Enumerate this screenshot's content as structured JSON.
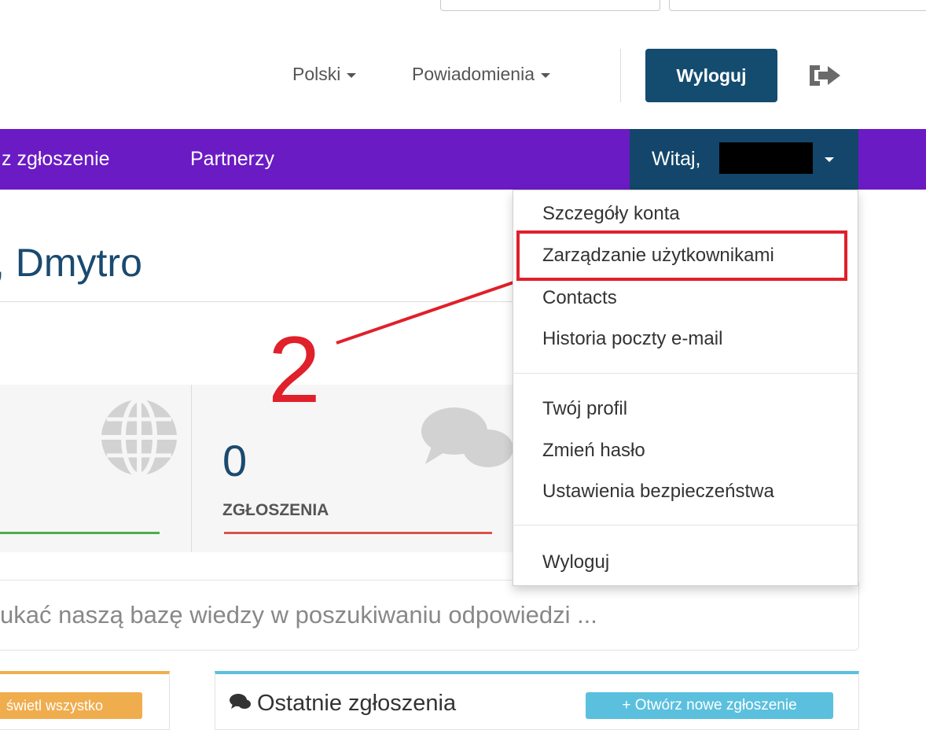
{
  "header": {
    "language": "Polski",
    "notifications": "Powiadomienia",
    "logout_button": "Wyloguj"
  },
  "nav": {
    "items": [
      "z zgłoszenie",
      "Partnerzy"
    ],
    "user_greeting": "Witaj,"
  },
  "page": {
    "title": ", Dmytro"
  },
  "stats": {
    "tickets_count": "0",
    "tickets_label": "ZGŁOSZENIA"
  },
  "knowledge_base": {
    "search_text": "ukać naszą bazę wiedzy w poszukiwaniu odpowiedzi ..."
  },
  "panels": {
    "left_button": "świetl wszystko",
    "recent_title": "Ostatnie zgłoszenia",
    "new_ticket_button": "+ Otwórz nowe zgłoszenie"
  },
  "user_menu": {
    "items": [
      "Szczegóły konta",
      "Zarządzanie użytkownikami",
      "Contacts",
      "Historia poczty e-mail",
      "Twój profil",
      "Zmień hasło",
      "Ustawienia bezpieczeństwa",
      "Wyloguj"
    ]
  },
  "annotation": {
    "step_number": "2"
  },
  "colors": {
    "nav_purple": "#6a1bc4",
    "dark_blue": "#13466a",
    "annotation_red": "#e0202a",
    "success_green": "#4cae4c",
    "danger_red": "#d9534f",
    "warning_orange": "#f0ad4e",
    "info_blue": "#5bc0de"
  }
}
